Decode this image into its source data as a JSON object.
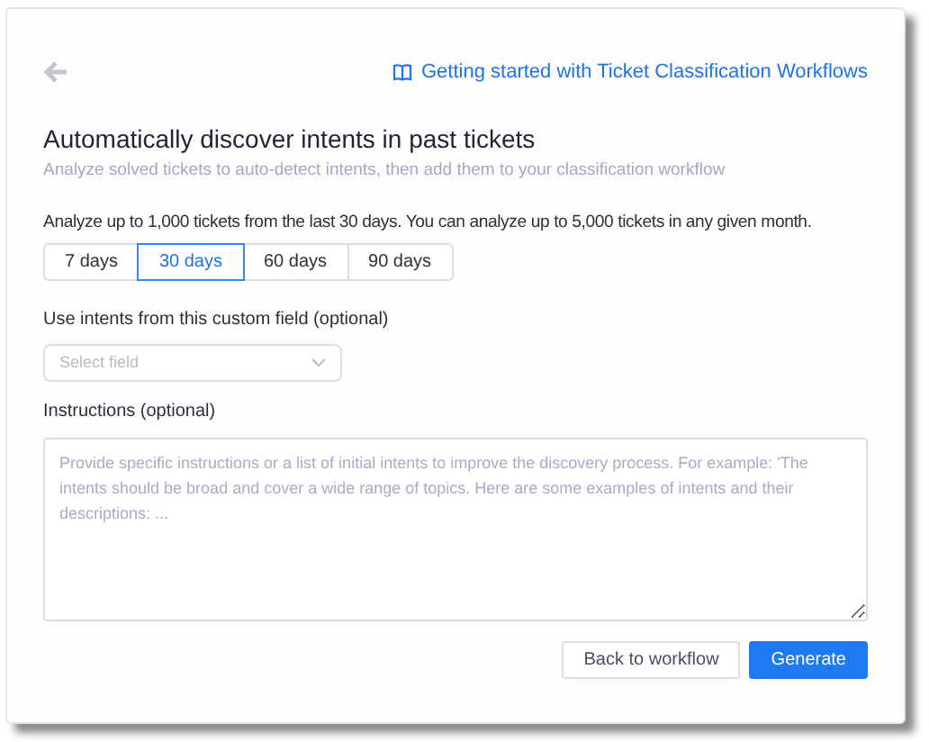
{
  "help_link": "Getting started with Ticket Classification Workflows",
  "title": "Automatically discover intents in past tickets",
  "subtitle": "Analyze solved tickets to auto-detect intents, then add them to your classification workflow",
  "range_note": "Analyze up to 1,000 tickets from the last 30 days. You can analyze up to 5,000 tickets in any given month.",
  "ranges": [
    {
      "label": "7 days",
      "selected": false
    },
    {
      "label": "30 days",
      "selected": true
    },
    {
      "label": "60 days",
      "selected": false
    },
    {
      "label": "90 days",
      "selected": false
    }
  ],
  "custom_field": {
    "label": "Use intents from this custom field (optional)",
    "placeholder": "Select field"
  },
  "instructions": {
    "label": "Instructions (optional)",
    "placeholder": "Provide specific instructions or a list of initial intents to improve the discovery process. For example: 'The intents should be broad and cover a wide range of topics. Here are some examples of intents and their descriptions: ..."
  },
  "buttons": [
    {
      "label": "Back to workflow",
      "kind": "secondary"
    },
    {
      "label": "Generate",
      "kind": "primary"
    }
  ]
}
